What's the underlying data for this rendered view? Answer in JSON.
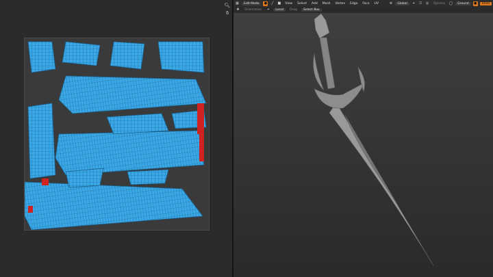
{
  "uv_editor": {
    "tools": [
      {
        "name": "zoom",
        "icon": "magnifier-icon"
      },
      {
        "name": "pan",
        "icon": "hand-icon"
      }
    ],
    "colors": {
      "island": "#3aa8e6",
      "island_edge": "#1b5f8c",
      "seam": "#d12222",
      "background": "#2b2b2b"
    }
  },
  "viewport": {
    "header": {
      "mode": "Edit Mode",
      "menus": [
        "View",
        "Select",
        "Add",
        "Mesh",
        "Vertex",
        "Edge",
        "Face",
        "UV"
      ],
      "transform_orientation": "Global",
      "snap": "Snap",
      "options": "Options",
      "overlay": "Ground",
      "shading": "Shad"
    },
    "subheader": {
      "orientation_label": "Orientation",
      "orientation_value": "Local",
      "drag_label": "Drag",
      "drag_value": "Select Box"
    },
    "colors": {
      "accent": "#e07a1f",
      "model": "#8c8c8c"
    }
  }
}
